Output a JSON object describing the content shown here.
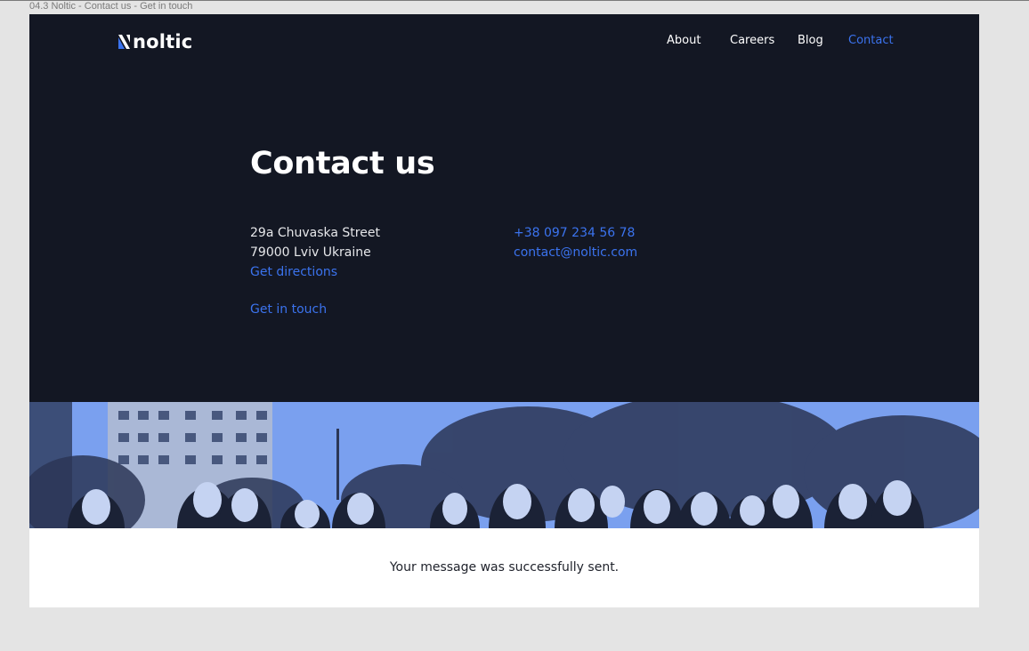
{
  "frame": {
    "label": "04.3 Noltic - Contact us - Get in touch"
  },
  "brand": {
    "name": "noltic"
  },
  "nav": {
    "items": [
      {
        "label": "About",
        "active": false
      },
      {
        "label": "Careers",
        "active": false
      },
      {
        "label": "Blog",
        "active": false
      },
      {
        "label": "Contact",
        "active": true
      }
    ]
  },
  "hero": {
    "title": "Contact us",
    "address": {
      "street": "29a Chuvaska Street",
      "city": "79000 Lviv Ukraine",
      "directions_link": "Get directions"
    },
    "contact": {
      "phone": "+38 097 234 56 78",
      "email": "contact@noltic.com"
    },
    "get_in_touch_link": "Get in touch"
  },
  "team_photo": {
    "icon": "team-photo"
  },
  "status": {
    "message": "Your message was successfully sent."
  },
  "colors": {
    "background": "#131723",
    "accent": "#3b73ee",
    "photo_tint": "#7aa0ef",
    "canvas": "#e4e4e4"
  }
}
